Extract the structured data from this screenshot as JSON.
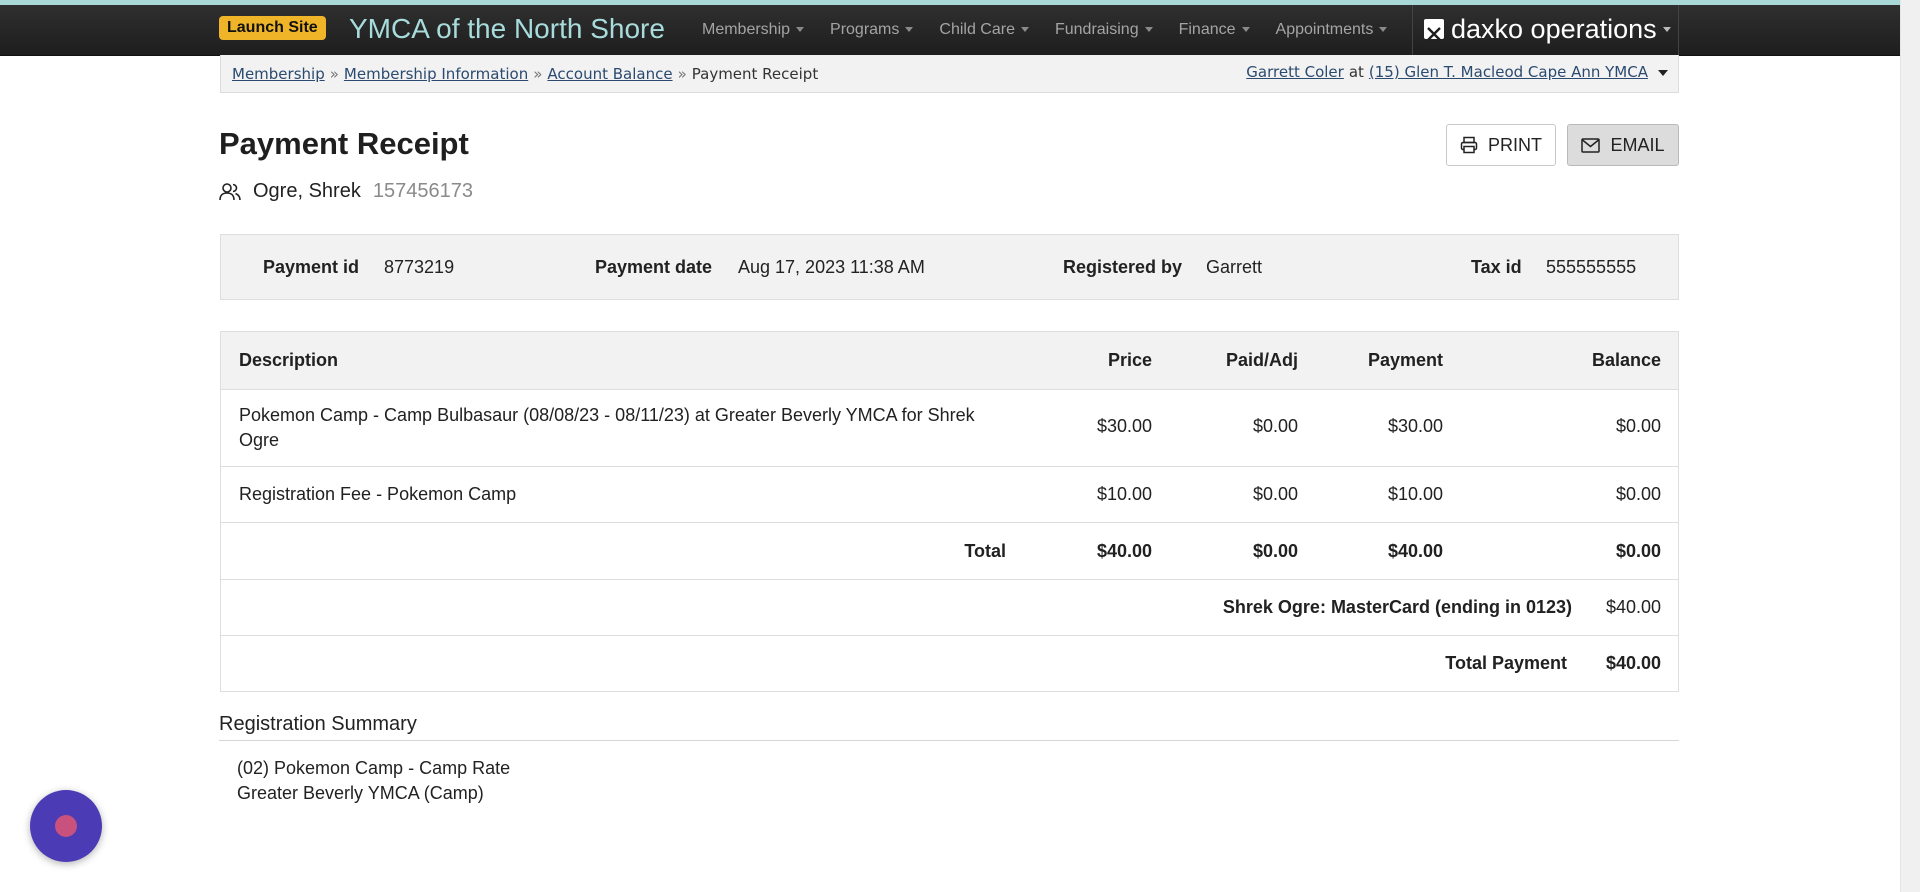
{
  "nav": {
    "launch_label": "Launch Site",
    "brand": "YMCA of the North Shore",
    "menu": [
      "Membership",
      "Programs",
      "Child Care",
      "Fundraising",
      "Finance",
      "Appointments"
    ],
    "product": "daxko operations"
  },
  "breadcrumb": {
    "items": [
      "Membership",
      "Membership Information",
      "Account Balance"
    ],
    "current": "Payment Receipt",
    "separator": "»"
  },
  "user": {
    "name": "Garrett Coler",
    "at": "at",
    "location": "(15) Glen T. Macleod Cape Ann YMCA"
  },
  "page": {
    "title": "Payment Receipt",
    "print_label": "PRINT",
    "email_label": "EMAIL"
  },
  "member": {
    "name": "Ogre, Shrek",
    "number": "157456173"
  },
  "payment_info": {
    "payment_id_label": "Payment id",
    "payment_id": "8773219",
    "payment_date_label": "Payment date",
    "payment_date": "Aug 17, 2023 11:38 AM",
    "registered_by_label": "Registered by",
    "registered_by": "Garrett",
    "tax_id_label": "Tax id",
    "tax_id": "555555555"
  },
  "table": {
    "headers": {
      "description": "Description",
      "price": "Price",
      "paid_adj": "Paid/Adj",
      "payment": "Payment",
      "balance": "Balance"
    },
    "rows": [
      {
        "description": "Pokemon Camp - Camp Bulbasaur (08/08/23 - 08/11/23) at Greater Beverly YMCA for Shrek Ogre",
        "price": "$30.00",
        "paid_adj": "$0.00",
        "payment": "$30.00",
        "balance": "$0.00"
      },
      {
        "description": "Registration Fee - Pokemon Camp",
        "price": "$10.00",
        "paid_adj": "$0.00",
        "payment": "$10.00",
        "balance": "$0.00"
      }
    ],
    "total": {
      "label": "Total",
      "price": "$40.00",
      "paid_adj": "$0.00",
      "payment": "$40.00",
      "balance": "$0.00"
    },
    "payment_method": {
      "label": "Shrek Ogre: MasterCard (ending in 0123)",
      "amount": "$40.00"
    },
    "total_payment": {
      "label": "Total Payment",
      "amount": "$40.00"
    }
  },
  "registration_summary": {
    "heading": "Registration Summary",
    "item_line1": "(02) Pokemon Camp - Camp Rate",
    "item_line2": "Greater Beverly YMCA (Camp)"
  },
  "colors": {
    "brand": "#a8dcdc",
    "launch": "#f0b429",
    "chat": "#4b3bb5"
  }
}
